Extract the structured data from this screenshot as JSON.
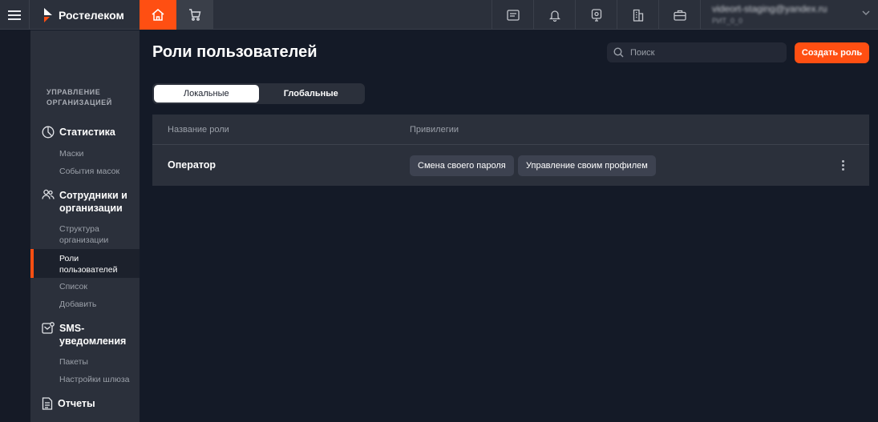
{
  "header": {
    "brand": "Ростелеком",
    "user_email": "videort-staging@yandex.ru",
    "user_sub": "РИТ_0_0",
    "colors": {
      "accent": "#ff4f12",
      "topbar": "#2b303b"
    },
    "icons": [
      "menu-icon",
      "home-icon",
      "cart-icon",
      "document-icon",
      "bell-icon",
      "camera-icon",
      "building-icon",
      "briefcase-icon",
      "chevron-down-icon"
    ]
  },
  "sidebar": {
    "heading": "Управление организацией",
    "sections": [
      {
        "label": "Статистика",
        "icon": "pie-chart-icon",
        "items": [
          "Маски",
          "События масок"
        ]
      },
      {
        "label": "Сотрудники и организации",
        "icon": "users-icon",
        "items": [
          "Структура организации",
          "Роли пользователей",
          "Список",
          "Добавить"
        ]
      },
      {
        "label": "SMS-уведомления",
        "icon": "sms-icon",
        "items": [
          "Пакеты",
          "Настройки шлюза"
        ]
      },
      {
        "label": "Отчеты",
        "icon": "report-icon",
        "items": []
      }
    ],
    "active_item": "Роли пользователей"
  },
  "main": {
    "title": "Роли пользователей",
    "search_placeholder": "Поиск",
    "create_button": "Создать роль",
    "tabs": [
      {
        "label": "Локальные",
        "active": true
      },
      {
        "label": "Глобальные",
        "active": false
      }
    ],
    "table": {
      "columns": [
        "Название роли",
        "Привилегии"
      ],
      "rows": [
        {
          "name": "Оператор",
          "privileges": [
            "Смена своего пароля",
            "Управление своим профилем"
          ]
        }
      ]
    }
  }
}
